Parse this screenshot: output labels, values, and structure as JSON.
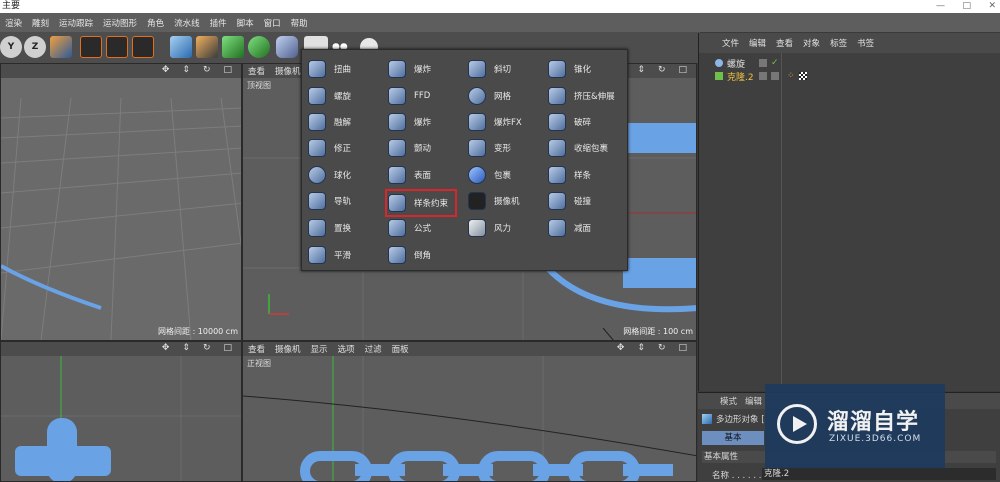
{
  "window": {
    "title": "主要"
  },
  "menubar": [
    "渲染",
    "雕刻",
    "运动跟踪",
    "运动图形",
    "角色",
    "流水线",
    "插件",
    "脚本",
    "窗口",
    "帮助"
  ],
  "viewport_tl": {
    "grid_spacing": "网格间距 : 10000 cm"
  },
  "viewport_tr": {
    "menu": [
      "查看",
      "摄像机"
    ],
    "label": "顶视图",
    "grid_spacing": "网格间距 : 100 cm"
  },
  "viewport_br": {
    "menu": [
      "查看",
      "摄像机",
      "显示",
      "选项",
      "过滤",
      "面板"
    ],
    "label": "正视图"
  },
  "deformer_menu": {
    "col1": [
      "扭曲",
      "螺旋",
      "融解",
      "修正",
      "球化",
      "导轨",
      "置换",
      "平滑"
    ],
    "col2": [
      "爆炸",
      "FFD",
      "爆炸",
      "颤动",
      "表面",
      "样条约束",
      "公式",
      "倒角"
    ],
    "col3": [
      "斜切",
      "网格",
      "爆炸FX",
      "变形",
      "包裹",
      "摄像机",
      "风力"
    ],
    "col4": [
      "锥化",
      "挤压&伸展",
      "破碎",
      "收缩包裹",
      "样条",
      "碰撞",
      "减面"
    ],
    "highlighted": "样条约束"
  },
  "object_manager": {
    "menu": [
      "文件",
      "编辑",
      "查看",
      "对象",
      "标签",
      "书签"
    ],
    "objects": [
      {
        "name": "螺旋"
      },
      {
        "name": "克隆.2"
      }
    ]
  },
  "attribute_manager": {
    "menu": [
      "模式",
      "编辑"
    ],
    "object_type": "多边形对象 [",
    "tab_basic": "基本",
    "section": "基本属性",
    "name_label": "名称 . . . . . .",
    "name_value": "克隆.2"
  },
  "watermark": {
    "title": "溜溜自学",
    "url": "ZIXUE.3D66.COM"
  },
  "colors": {
    "accent_select": "#d9262a",
    "menu_bg": "#5e5e5e",
    "viewport_bg": "#5d5d5d",
    "chain_blue": "#6aa2e6"
  }
}
